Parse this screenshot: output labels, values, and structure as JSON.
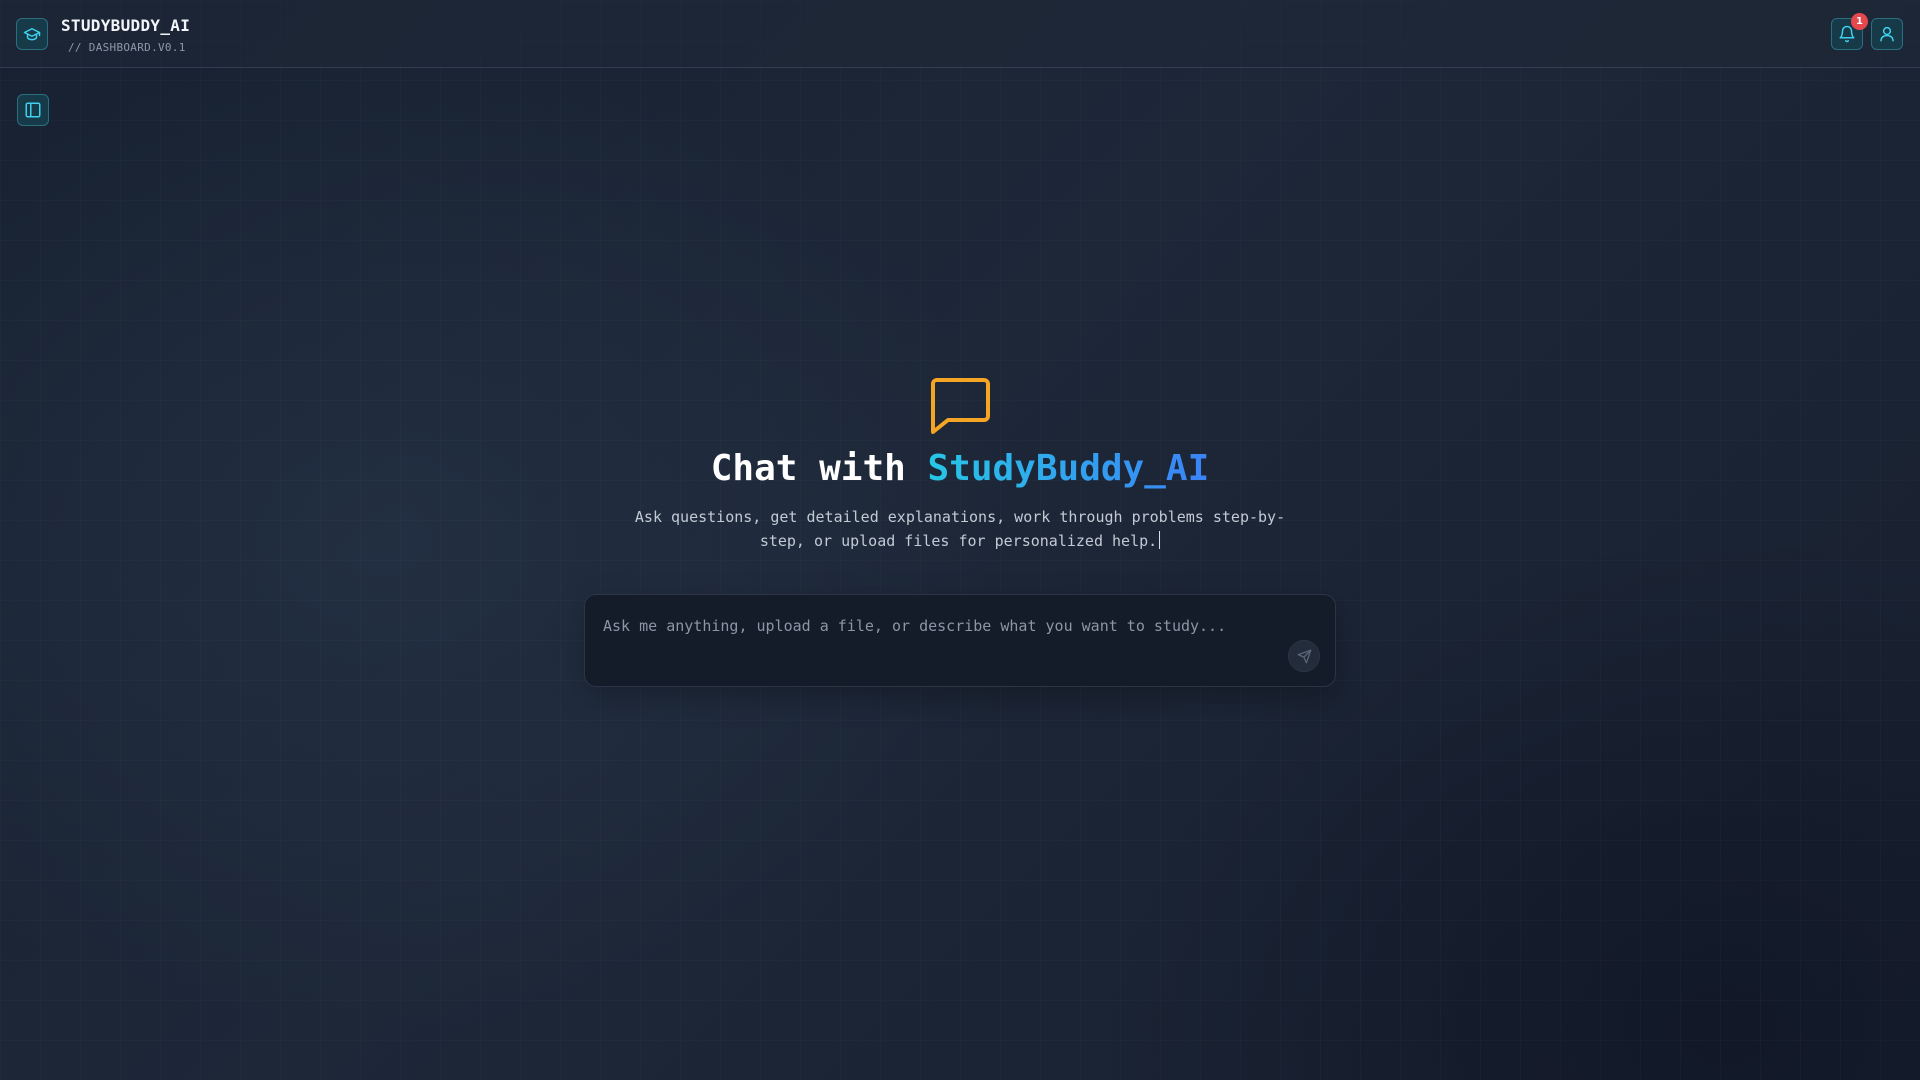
{
  "header": {
    "app_title": "STUDYBUDDY_AI",
    "subtitle": "// DASHBOARD.V0.1",
    "logo_icon": "graduation-cap-icon",
    "notifications": {
      "icon": "bell-icon",
      "badge_count": "1"
    },
    "user_icon": "user-icon"
  },
  "sidebar_toggle": {
    "icon": "sidebar-panel-icon"
  },
  "hero": {
    "icon": "chat-bubble-icon",
    "title_prefix": "Chat with ",
    "title_accent": "StudyBuddy_AI",
    "description": "Ask questions, get detailed explanations, work through problems step-by-step, or upload files for personalized help."
  },
  "chat": {
    "placeholder": "Ask me anything, upload a file, or describe what you want to study...",
    "value": "",
    "send_icon": "send-icon"
  },
  "colors": {
    "accent_cyan": "#27c7e6",
    "accent_blue": "#3b82f6",
    "icon_orange": "#f5a524",
    "badge_red": "#e5484d",
    "background": "#1a2333"
  }
}
